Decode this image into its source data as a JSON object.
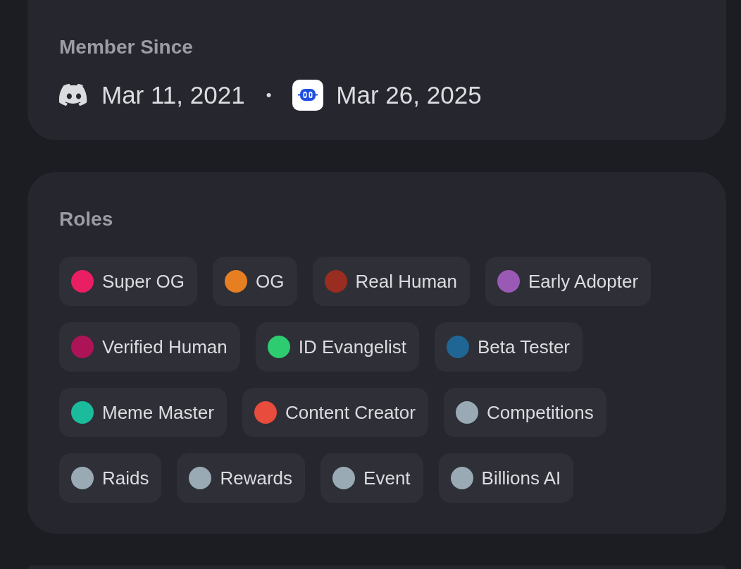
{
  "member_since": {
    "title": "Member Since",
    "discord_date": "Mar 11, 2021",
    "separator": "•",
    "app_date": "Mar 26, 2025"
  },
  "roles": {
    "title": "Roles",
    "items": [
      {
        "label": "Super OG",
        "color": "#e91e63"
      },
      {
        "label": "OG",
        "color": "#e67e22"
      },
      {
        "label": "Real Human",
        "color": "#992d22"
      },
      {
        "label": "Early Adopter",
        "color": "#9b59b6"
      },
      {
        "label": "Verified Human",
        "color": "#ad1457"
      },
      {
        "label": "ID Evangelist",
        "color": "#2ecc71"
      },
      {
        "label": "Beta Tester",
        "color": "#206694"
      },
      {
        "label": "Meme Master",
        "color": "#1abc9c"
      },
      {
        "label": "Content Creator",
        "color": "#e74c3c"
      },
      {
        "label": "Competitions",
        "color": "#99aab5"
      },
      {
        "label": "Raids",
        "color": "#99aab5"
      },
      {
        "label": "Rewards",
        "color": "#99aab5"
      },
      {
        "label": "Event",
        "color": "#99aab5"
      },
      {
        "label": "Billions AI",
        "color": "#99aab5"
      }
    ]
  }
}
